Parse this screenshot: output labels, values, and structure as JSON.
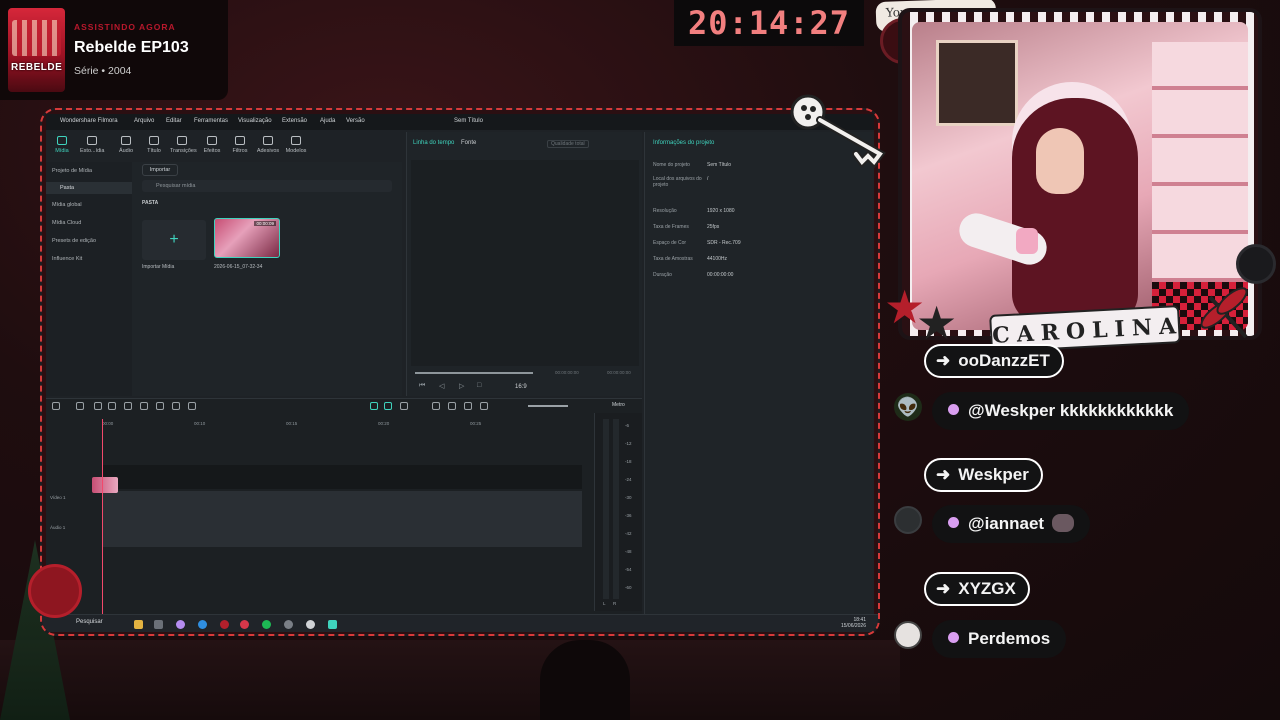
{
  "overlay": {
    "now_watching": {
      "kicker": "ASSISTINDO AGORA",
      "title": "Rebelde EP103",
      "meta": "Série • 2004",
      "poster_logo": "REBELDE"
    },
    "clock": "20:14:27",
    "streamer_name": "CAROLINA",
    "sticker_text": "You are"
  },
  "app": {
    "titlebar": {
      "app_name": "Wondershare Filmora",
      "menus": [
        "Arquivo",
        "Editar",
        "Ferramentas",
        "Visualização",
        "Extensão",
        "Ajuda",
        "Versão"
      ],
      "doc_title": "Sem Título"
    },
    "toolbar": [
      "Mídia",
      "Esto...ídia",
      "Áudio",
      "Título",
      "Transições",
      "Efeitos",
      "Filtros",
      "Adesivos",
      "Modelos"
    ],
    "sidebar": [
      "Projeto de Mídia",
      "Pasta",
      "Mídia global",
      "Mídia Cloud",
      "Presets de edição",
      "Influence Kit"
    ],
    "media": {
      "import_label": "Importar",
      "search_placeholder": "Pesquisar mídia",
      "folder_label": "PASTA",
      "import_tile_label": "Importar Mídia",
      "clip_label": "2026-06-15_07-32-34",
      "clip_duration": "00:00:09"
    },
    "player": {
      "tab_timeline": "Linha do tempo",
      "tab_source": "Fonte",
      "quality": "Qualidade total",
      "current_time": "00:00:00:00",
      "total_time": "00:00:00:00",
      "ratio": "16:9"
    },
    "info": {
      "heading": "Informações do projeto",
      "rows": [
        {
          "k": "Nome do projeto",
          "v": "Sem Título"
        },
        {
          "k": "Local dos arquivos do projeto",
          "v": "/"
        },
        {
          "k": "Resolução",
          "v": "1920 x 1080"
        },
        {
          "k": "Taxa de Frames",
          "v": "25fps"
        },
        {
          "k": "Espaço de Cor",
          "v": "SDR - Rec.709"
        },
        {
          "k": "Taxa de Amostras",
          "v": "44100Hz"
        },
        {
          "k": "Duração",
          "v": "00:00:00:00"
        }
      ]
    },
    "timeline": {
      "ruler": [
        "00:00",
        "00:10",
        "00:15",
        "00:20",
        "00:25"
      ],
      "track_video": "Vídeo 1",
      "track_audio": "Áudio 1",
      "meter_label": "Metro",
      "db_scale": [
        "-6",
        "-12",
        "-18",
        "-24",
        "-30",
        "-36",
        "-42",
        "-48",
        "-54",
        "-60"
      ],
      "meter_lr": [
        "L",
        "R"
      ]
    },
    "taskbar": {
      "search": "Pesquisar",
      "time": "18:41",
      "date": "15/06/2026"
    }
  },
  "chat": [
    {
      "type": "follow",
      "text": "ooDanzzET"
    },
    {
      "type": "message",
      "avatar": "alien-avatar",
      "text": "@Weskper kkkkkkkkkkkk"
    },
    {
      "type": "follow",
      "text": "Weskper"
    },
    {
      "type": "message",
      "avatar": "dark-avatar",
      "text": "@iannaet"
    },
    {
      "type": "follow",
      "text": "XYZGX"
    },
    {
      "type": "message",
      "avatar": "cat-avatar",
      "text": "Perdemos"
    }
  ],
  "colors": {
    "accent_teal": "#3fd3bd",
    "frame_red": "#d73a3a",
    "clock_red": "#f27f7f",
    "chat_dot": "#d99ef0"
  }
}
